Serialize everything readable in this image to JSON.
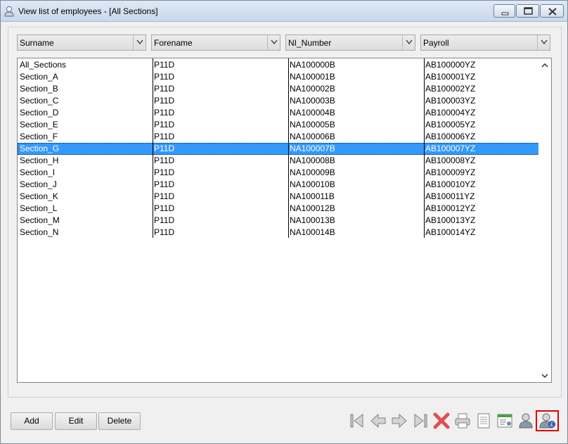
{
  "window": {
    "title": "View list of employees - [All Sections]"
  },
  "filters": {
    "surname": "Surname",
    "forename": "Forename",
    "ni_number": "NI_Number",
    "payroll": "Payroll"
  },
  "grid": {
    "rows": [
      [
        "All_Sections",
        "P11D",
        "NA100000B",
        "AB100000YZ"
      ],
      [
        "Section_A",
        "P11D",
        "NA100001B",
        "AB100001YZ"
      ],
      [
        "Section_B",
        "P11D",
        "NA100002B",
        "AB100002YZ"
      ],
      [
        "Section_C",
        "P11D",
        "NA100003B",
        "AB100003YZ"
      ],
      [
        "Section_D",
        "P11D",
        "NA100004B",
        "AB100004YZ"
      ],
      [
        "Section_E",
        "P11D",
        "NA100005B",
        "AB100005YZ"
      ],
      [
        "Section_F",
        "P11D",
        "NA100006B",
        "AB100006YZ"
      ],
      [
        "Section_G",
        "P11D",
        "NA100007B",
        "AB100007YZ"
      ],
      [
        "Section_H",
        "P11D",
        "NA100008B",
        "AB100008YZ"
      ],
      [
        "Section_I",
        "P11D",
        "NA100009B",
        "AB100009YZ"
      ],
      [
        "Section_J",
        "P11D",
        "NA100010B",
        "AB100010YZ"
      ],
      [
        "Section_K",
        "P11D",
        "NA100011B",
        "AB100011YZ"
      ],
      [
        "Section_L",
        "P11D",
        "NA100012B",
        "AB100012YZ"
      ],
      [
        "Section_M",
        "P11D",
        "NA100013B",
        "AB100013YZ"
      ],
      [
        "Section_N",
        "P11D",
        "NA100014B",
        "AB100014YZ"
      ]
    ],
    "selected_row": "Section_G"
  },
  "buttons": {
    "add": "Add",
    "edit": "Edit",
    "delete": "Delete"
  },
  "toolbar": {
    "icons": [
      "first-record-icon",
      "previous-record-icon",
      "next-record-icon",
      "last-record-icon",
      "delete-record-icon",
      "print-icon",
      "notes-icon",
      "report-icon",
      "employee-icon",
      "employee-pay-icon"
    ],
    "highlighted": "employee-pay-icon"
  },
  "colors": {
    "selection": "#3399ff",
    "highlight_border": "#e00000"
  }
}
